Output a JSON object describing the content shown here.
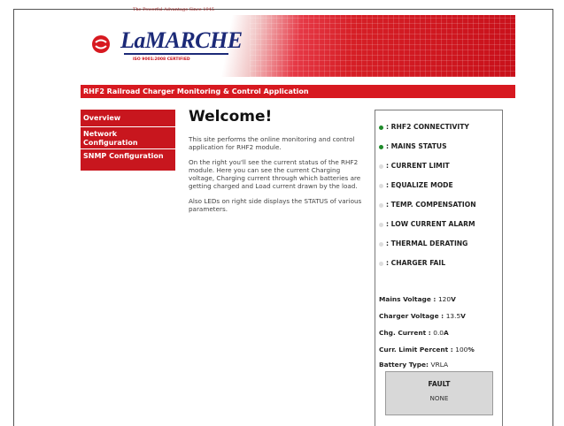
{
  "header": {
    "tagline": "The Powerful Advantage    Since 1945",
    "logo_text": "LaMARCHE",
    "iso": "ISO 9001:2008 CERTIFIED"
  },
  "title_bar": "RHF2 Railroad Charger Monitoring & Control Application",
  "sidebar": {
    "items": [
      {
        "label": "Overview"
      },
      {
        "label": "Network Configuration"
      },
      {
        "label": "SNMP Configuration"
      }
    ]
  },
  "main": {
    "heading": "Welcome!",
    "paragraphs": [
      "This site performs the online monitoring and control application for RHF2 module.",
      "On the right you'll see the current status of the RHF2 module. Here you can see the current Charging voltage, Charging current through which batteries are getting charged and Load current drawn by the load.",
      "Also LEDs on right side displays the STATUS of various parameters."
    ]
  },
  "status": {
    "leds": [
      {
        "label": ": RHF2 CONNECTIVITY",
        "state": "on"
      },
      {
        "label": ": MAINS STATUS",
        "state": "on"
      },
      {
        "label": ": CURRENT LIMIT",
        "state": "off"
      },
      {
        "label": ": EQUALIZE MODE",
        "state": "off"
      },
      {
        "label": ": TEMP. COMPENSATION",
        "state": "off"
      },
      {
        "label": ": LOW CURRENT ALARM",
        "state": "off"
      },
      {
        "label": ": THERMAL DERATING",
        "state": "off"
      },
      {
        "label": ": CHARGER FAIL",
        "state": "off"
      }
    ],
    "led_colors": {
      "on": "#1e8a2a",
      "off": "#dcdcdc"
    },
    "readouts": [
      {
        "label": "Mains Voltage : ",
        "value": "120",
        "unit": "V"
      },
      {
        "label": "Charger Voltage : ",
        "value": "13.5",
        "unit": "V"
      },
      {
        "label": "Chg. Current : ",
        "value": "0.0",
        "unit": "A"
      },
      {
        "label": "Curr. Limit Percent : ",
        "value": "100",
        "unit": "%"
      },
      {
        "label": "Battery Type: ",
        "value": "VRLA",
        "unit": ""
      }
    ],
    "fault": {
      "title": "FAULT",
      "value": "NONE"
    }
  },
  "colors": {
    "brand_red": "#d71920",
    "logo_blue": "#1c2a78"
  }
}
